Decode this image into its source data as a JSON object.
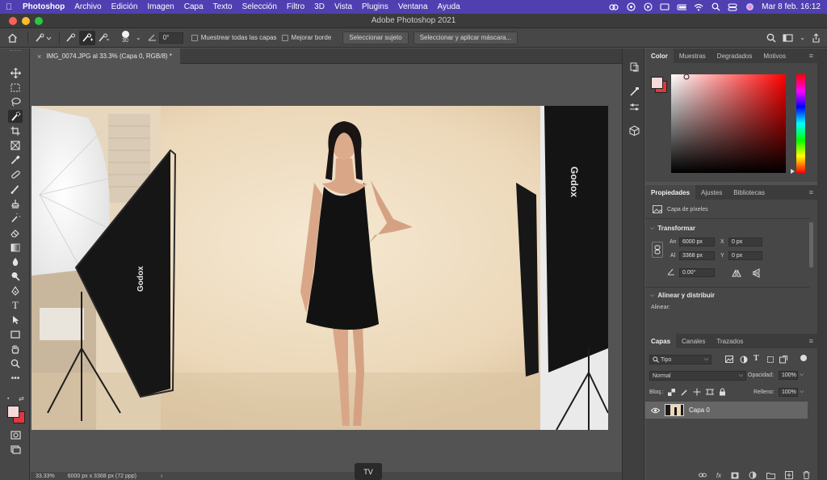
{
  "menubar": {
    "app_name": "Photoshop",
    "items": [
      "Archivo",
      "Edición",
      "Imagen",
      "Capa",
      "Texto",
      "Selección",
      "Filtro",
      "3D",
      "Vista",
      "Plugins",
      "Ventana",
      "Ayuda"
    ],
    "clock": "Mar 8 feb.  16:12"
  },
  "window": {
    "title": "Adobe Photoshop 2021"
  },
  "options": {
    "brush_size": "30",
    "angle_value": "0°",
    "sample_all_layers": "Muestrear todas las capas",
    "enhance_edge": "Mejorar borde",
    "select_subject": "Seleccionar sujeto",
    "select_and_mask": "Seleccionar y aplicar máscara..."
  },
  "document": {
    "tab_title": "IMG_0074.JPG al 33.3% (Capa 0, RGB/8) *",
    "close_glyph": "×",
    "zoom": "33.33%",
    "dimensions": "6000 px x 3368 px (72 ppp)",
    "status_arrow": "›"
  },
  "tv_button": "TV",
  "color_panel": {
    "tabs": [
      "Color",
      "Muestras",
      "Degradados",
      "Motivos"
    ],
    "foreground": "#f7d9d9",
    "background": "#e0383e",
    "hue_color": "#ff0000"
  },
  "properties_panel": {
    "tabs": [
      "Propiedades",
      "Ajustes",
      "Bibliotecas"
    ],
    "layer_type": "Capa de píxeles",
    "transform_heading": "Transformar",
    "width_label": "An",
    "width_value": "6000 px",
    "x_label": "X",
    "x_value": "0 px",
    "height_label": "Al",
    "height_value": "3368 px",
    "y_label": "Y",
    "y_value": "0 px",
    "angle_value": "0.00°",
    "align_heading": "Alinear y distribuir",
    "align_label": "Alinear:"
  },
  "layers_panel": {
    "tabs": [
      "Capas",
      "Canales",
      "Trazados"
    ],
    "filter_kind": "Tipo",
    "blend_mode": "Normal",
    "opacity_label": "Opacidad:",
    "opacity_value": "100%",
    "lock_label": "Bloq.:",
    "fill_label": "Relleno:",
    "fill_value": "100%",
    "layers": [
      {
        "name": "Capa 0"
      }
    ],
    "footer_fx": "fx"
  },
  "photo": {
    "brand_text": "Godox"
  }
}
